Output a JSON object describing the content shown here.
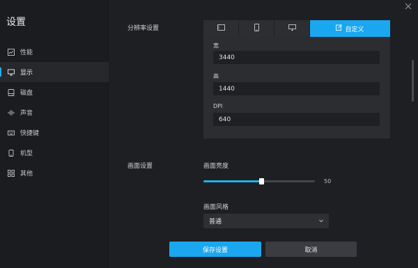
{
  "sidebar": {
    "title": "设置",
    "items": [
      {
        "label": "性能",
        "icon": "chart-icon",
        "active": false
      },
      {
        "label": "显示",
        "icon": "monitor-icon",
        "active": true
      },
      {
        "label": "磁盘",
        "icon": "disk-icon",
        "active": false
      },
      {
        "label": "声音",
        "icon": "sound-wave-icon",
        "active": false
      },
      {
        "label": "快捷键",
        "icon": "keyboard-icon",
        "active": false
      },
      {
        "label": "机型",
        "icon": "phone-icon",
        "active": false
      },
      {
        "label": "其他",
        "icon": "grid-icon",
        "active": false
      }
    ]
  },
  "resolution": {
    "section_label": "分辨率设置",
    "tabs": [
      {
        "icon": "tablet-landscape-icon"
      },
      {
        "icon": "phone-portrait-icon"
      },
      {
        "icon": "monitor-icon"
      },
      {
        "icon": "edit-icon",
        "label": "自定义",
        "active": true
      }
    ],
    "width_label": "宽",
    "width_value": "3440",
    "height_label": "高",
    "height_value": "1440",
    "dpi_label": "DPI",
    "dpi_value": "640"
  },
  "screen": {
    "section_label": "画面设置",
    "brightness_label": "画面亮度",
    "brightness_value": "50",
    "brightness_fraction": 0.52,
    "style_label": "画面风格",
    "style_value": "普通"
  },
  "actions": {
    "save_label": "保存设置",
    "cancel_label": "取消"
  },
  "colors": {
    "accent": "#1aa7f0",
    "background": "#1d1f22",
    "panel": "#2b2d31"
  }
}
